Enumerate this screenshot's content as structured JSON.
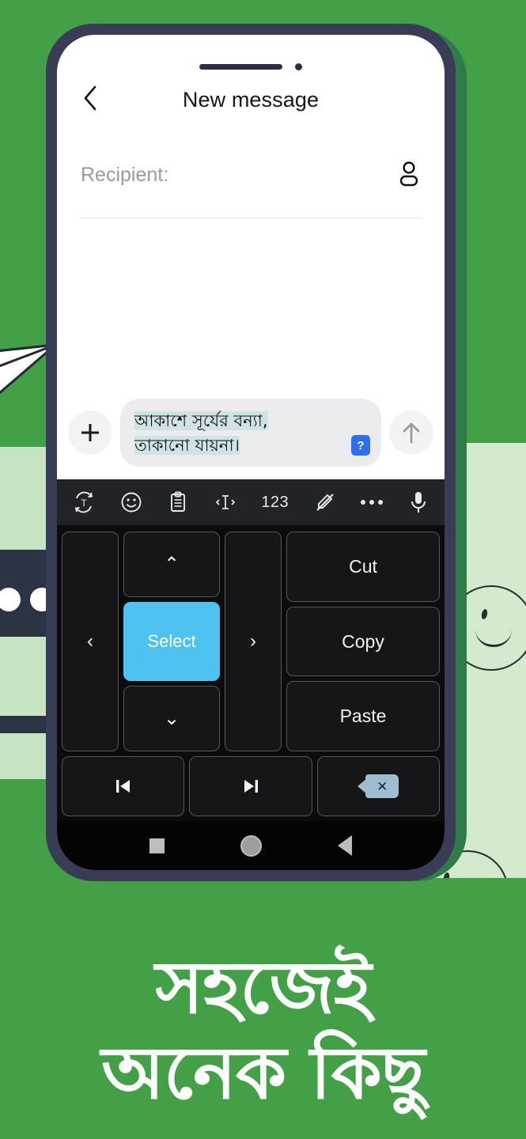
{
  "theme": {
    "background_green": "#43a047",
    "phone_frame": "#393c54",
    "accent_blue": "#4ec3f0",
    "keyboard_bg": "#0c0c0e",
    "key_bg": "#161618",
    "toolbar_bg": "#222326",
    "headline_color": "#ffffff",
    "highlight_color": "#cfe3e6"
  },
  "phone": {
    "hardware": {
      "speaker_icon": "speaker-grille",
      "camera_icon": "front-camera-dot"
    }
  },
  "app": {
    "header": {
      "back_icon": "chevron-left-icon",
      "title": "New message"
    },
    "recipient": {
      "label": "Recipient:",
      "placeholder": "Recipient:",
      "contact_icon": "contact-person-icon"
    },
    "compose": {
      "attach_icon": "plus-icon",
      "attach_label": "+",
      "send_icon": "arrow-up-icon",
      "message_line_1": "আকাশে সূর্যের বন্যা,",
      "message_line_2": "তাকানো যায়না।",
      "badge_label": "?",
      "badge_icon": "missing-glyph-tofu-icon"
    }
  },
  "keyboard": {
    "toolbar": [
      {
        "icon": "transliterate-icon",
        "label": ""
      },
      {
        "icon": "emoji-smiley-icon",
        "label": ""
      },
      {
        "icon": "clipboard-icon",
        "label": ""
      },
      {
        "icon": "text-cursor-icon",
        "label": ""
      },
      {
        "icon": "numbers-icon",
        "label": "123"
      },
      {
        "icon": "handwriting-off-icon",
        "label": ""
      },
      {
        "icon": "more-options-icon",
        "label": ""
      },
      {
        "icon": "microphone-icon",
        "label": ""
      }
    ],
    "keys": {
      "left_arrow": "‹",
      "up_arrow": "⌃",
      "down_arrow": "⌄",
      "right_arrow": "›",
      "select": "Select",
      "cut": "Cut",
      "copy": "Copy",
      "paste": "Paste",
      "jump_start_icon": "jump-to-start-icon",
      "jump_end_icon": "jump-to-end-icon",
      "backspace_icon": "backspace-delete-icon"
    }
  },
  "navbar": {
    "recents_icon": "recents-square-icon",
    "home_icon": "home-circle-icon",
    "back_icon": "back-triangle-icon"
  },
  "promo": {
    "headline_line_1": "সহজেই",
    "headline_line_2": "অনেক কিছু"
  }
}
